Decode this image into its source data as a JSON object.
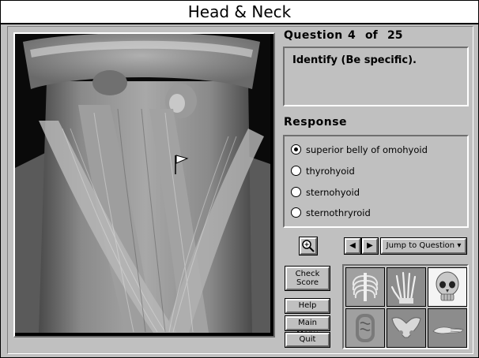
{
  "app": {
    "title": "Head & Neck"
  },
  "question": {
    "label": "Question",
    "number": "4",
    "of": "of",
    "total": "25",
    "prompt": "Identify (Be specific)."
  },
  "response": {
    "label": "Response",
    "options": [
      {
        "label": "superior belly of omohyoid",
        "selected": true
      },
      {
        "label": "thyrohyoid",
        "selected": false
      },
      {
        "label": "sternohyoid",
        "selected": false
      },
      {
        "label": "sternothryroid",
        "selected": false
      }
    ]
  },
  "controls": {
    "zoom_icon": "magnifier-plus-icon",
    "prev_icon": "triangle-left-icon",
    "next_icon": "triangle-right-icon",
    "jump_label": "Jump to Question",
    "check_label_1": "Check",
    "check_label_2": "Score",
    "help_label": "Help",
    "menu_label": "Main Menu",
    "quit_label": "Quit"
  },
  "regions": [
    "thorax",
    "hand",
    "skull",
    "abdomen",
    "pelvis",
    "foot"
  ]
}
